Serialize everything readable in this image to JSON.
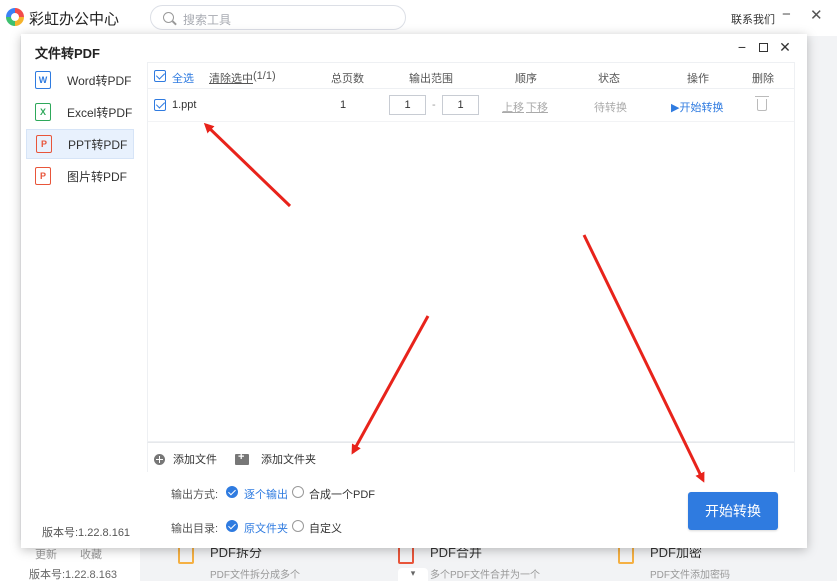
{
  "background": {
    "app_title": "彩虹办公中心",
    "search_placeholder": "搜索工具",
    "contact": "联系我们",
    "minimize": "−",
    "close": "✕",
    "links": [
      "更新",
      "收藏"
    ],
    "version": "版本号:1.22.8.163",
    "cards": [
      {
        "title": "PDF拆分",
        "desc": "PDF文件拆分成多个"
      },
      {
        "title": "PDF合并",
        "desc": "多个PDF文件合并为一个"
      },
      {
        "title": "PDF加密",
        "desc": "PDF文件添加密码"
      }
    ],
    "dropdown": "▾"
  },
  "dialog": {
    "title": "文件转PDF",
    "minimize": "−",
    "close": "✕",
    "version": "版本号:1.22.8.161",
    "nav": [
      {
        "label": "Word转PDF",
        "icon": "word-icon",
        "color": "#2f7be0"
      },
      {
        "label": "Excel转PDF",
        "icon": "excel-icon",
        "color": "#2ea85a"
      },
      {
        "label": "PPT转PDF",
        "icon": "ppt-icon",
        "color": "#e8553a"
      },
      {
        "label": "图片转PDF",
        "icon": "image-icon",
        "color": "#e8553a"
      }
    ],
    "table": {
      "select_all": "全选",
      "clear_selected": "清除选中",
      "selected_count": "(1/1)",
      "headers": {
        "pages": "总页数",
        "range": "输出范围",
        "order": "顺序",
        "status": "状态",
        "action": "操作",
        "delete": "删除"
      },
      "rows": [
        {
          "name": "1.ppt",
          "pages": "1",
          "range_from": "1",
          "range_sep": "-",
          "range_to": "1",
          "move_up": "上移",
          "move_down": "下移",
          "status": "待转换",
          "action": "▶开始转换"
        }
      ]
    },
    "toolbar": {
      "add_file": "添加文件",
      "add_folder": "添加文件夹"
    },
    "output": {
      "mode_label": "输出方式:",
      "mode_options": [
        "逐个输出",
        "合成一个PDF"
      ],
      "dir_label": "输出目录:",
      "dir_options": [
        "原文件夹",
        "自定义"
      ]
    },
    "start_button": "开始转换"
  },
  "colors": {
    "accent": "#2f7be0",
    "arrow": "#e8231b"
  }
}
